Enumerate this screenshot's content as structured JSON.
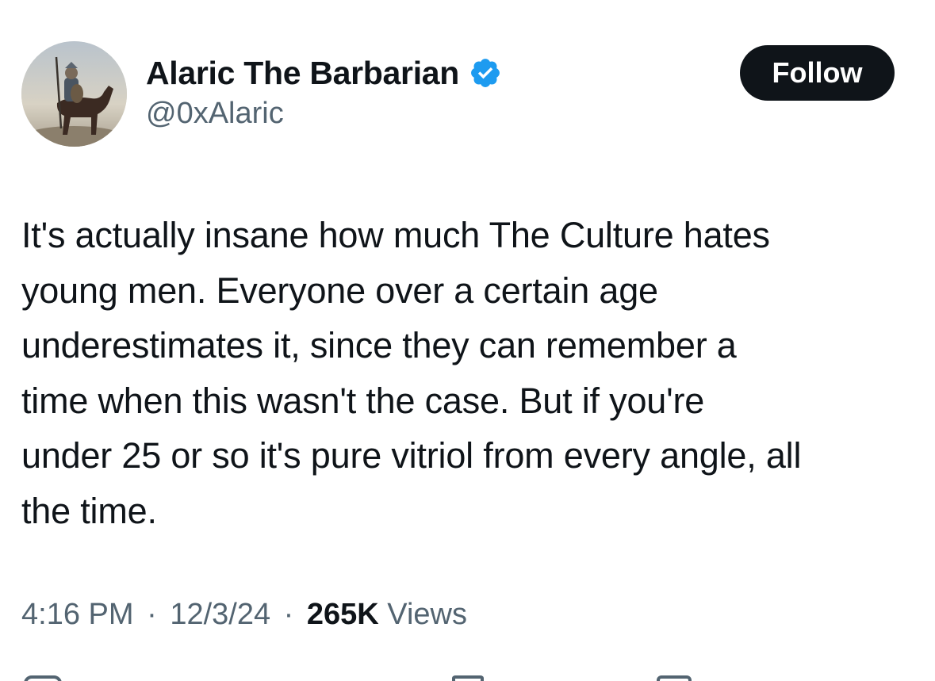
{
  "author": {
    "display_name": "Alaric The Barbarian",
    "handle": "@0xAlaric",
    "verified": true,
    "verified_color": "#1d9bf0",
    "avatar_icon": "avatar-horseman-image"
  },
  "follow_button": {
    "label": "Follow"
  },
  "tweet": {
    "lines": [
      "It's actually insane how much The Culture hates",
      "young men. Everyone over a certain age",
      "underestimates it, since they can remember a",
      "time when this wasn't the case. But if you're",
      "under 25 or so it's pure vitriol from every angle, all",
      "the time."
    ]
  },
  "meta": {
    "time": "4:16 PM",
    "date": "12/3/24",
    "views_count": "265K",
    "views_label": "Views",
    "separator": "·"
  },
  "actions": {
    "icons": [
      "reply-icon",
      "retweet-icon",
      "like-icon",
      "bookmark-icon"
    ]
  },
  "colors": {
    "text": "#0f1419",
    "secondary_text": "#536471",
    "button_bg": "#0f1419",
    "button_text": "#ffffff",
    "background": "#ffffff"
  }
}
